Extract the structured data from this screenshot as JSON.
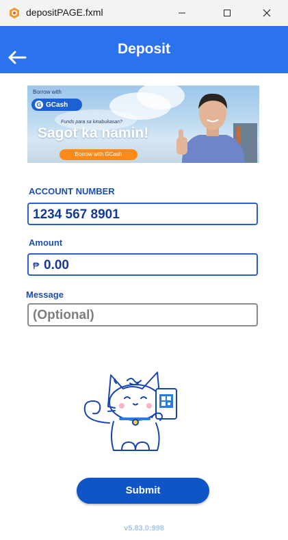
{
  "window": {
    "title": "depositPAGE.fxml",
    "app_icon": "orange-hexagon-icon",
    "controls": [
      "minimize-icon",
      "maximize-icon",
      "close-icon"
    ]
  },
  "header": {
    "title": "Deposit",
    "back_icon": "arrow-left-icon",
    "color": "#2a72ee"
  },
  "banner": {
    "borrow_small": "Borrow with",
    "brand": "GCash",
    "funds_text": "Funds para sa kinabukasan?",
    "headline": "Sagot ka namin!",
    "cta": "Borrow with GCash"
  },
  "form": {
    "account_label": "ACCOUNT NUMBER",
    "account_value": "1234 567 8901",
    "amount_label": "Amount",
    "amount_currency": "₱",
    "amount_value": "0.00",
    "message_label": "Message",
    "message_placeholder": "(Optional)"
  },
  "illustration": "cat-holding-qr-phone-icon",
  "submit_label": "Submit",
  "version": "v5.83.0:998",
  "colors": {
    "primary": "#0e56c8",
    "label": "#1a4db5",
    "version": "#a5c5e4"
  }
}
